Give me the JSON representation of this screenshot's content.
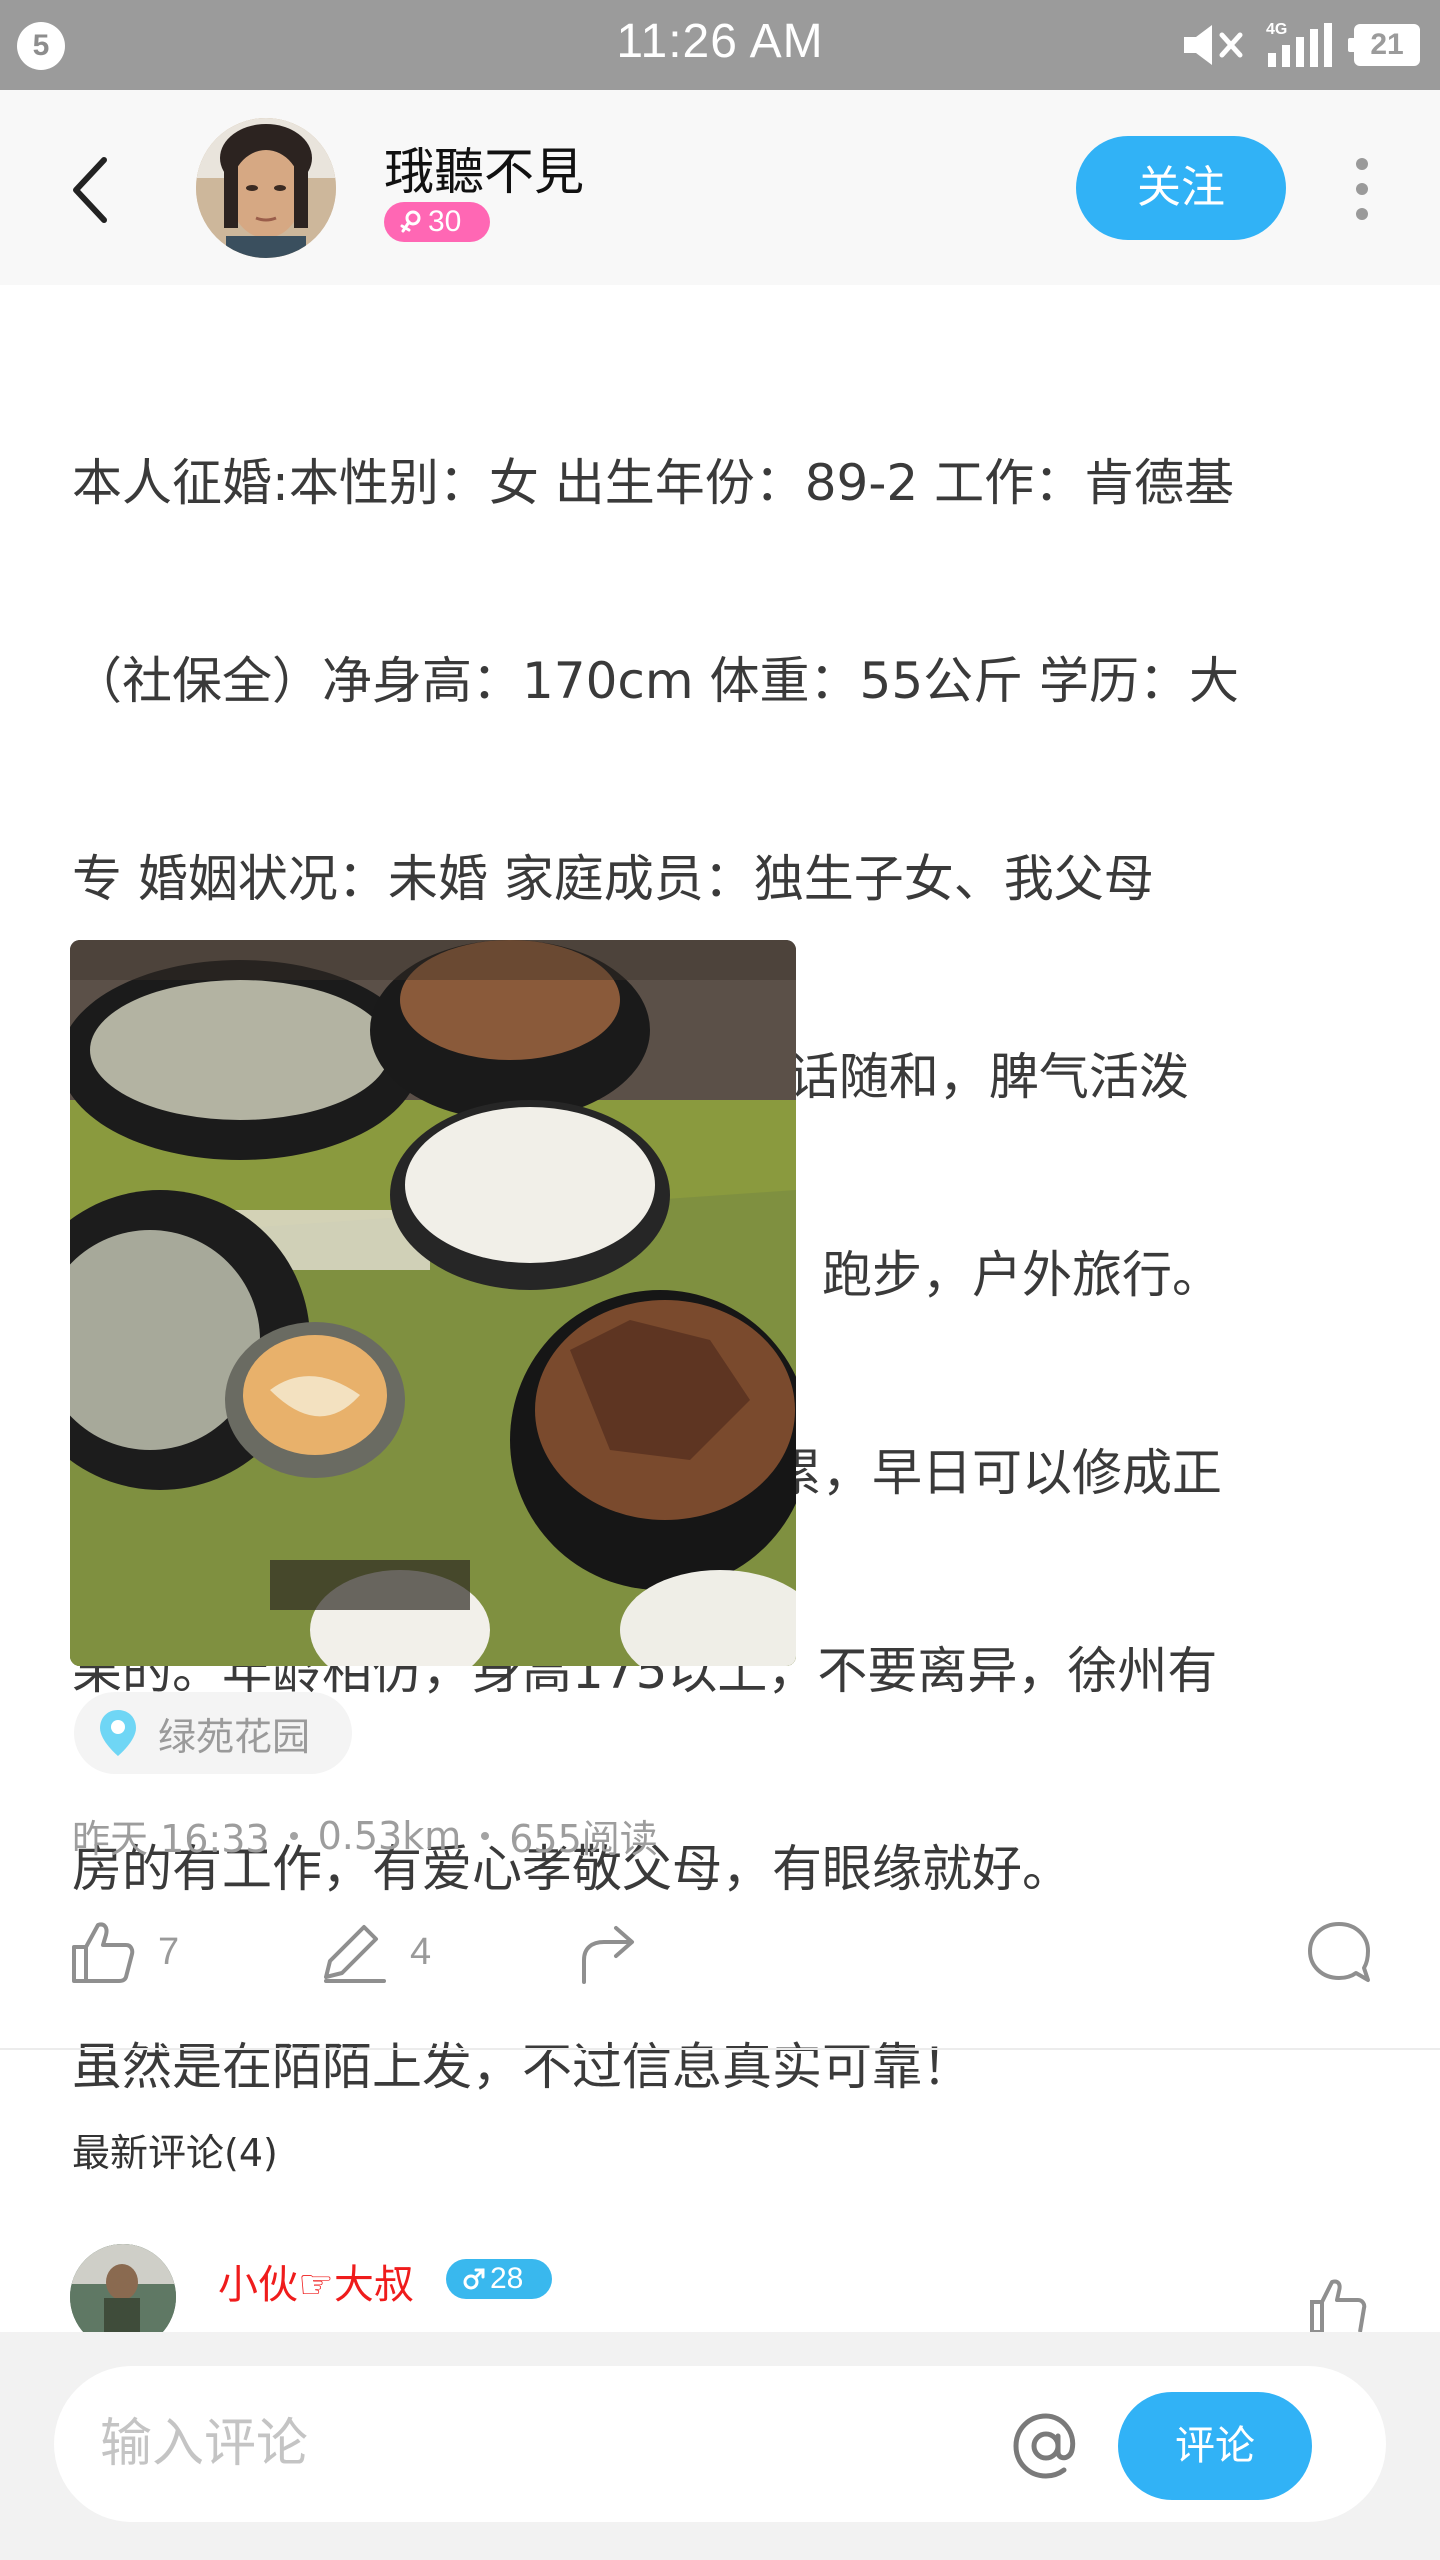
{
  "status_bar": {
    "notification_count": "5",
    "time": "11:26 AM",
    "network_label": "4G",
    "battery": "21",
    "icons": [
      "mute-icon",
      "signal-icon",
      "battery-icon"
    ]
  },
  "header": {
    "user_name": "珴聽不見",
    "gender_icon": "female-icon",
    "age": "30",
    "follow_label": "关注",
    "colors": {
      "accent": "#31b2f6",
      "female_badge": "#ff67b4",
      "male_badge": "#39b8ee"
    }
  },
  "post": {
    "text_lines": [
      "本人征婚:本性别：女 出生年份：89-2 工作：肯德基",
      "（社保全）净身高：170cm 体重：55公斤 学历：大",
      "专 婚姻状况：未婚 家庭成员：独生子女、我父母",
      "自我描述:听力不好戴助听器。说话随和，脾气活泼",
      "开朗大方。喜欢狗狗，打羽毛球，跑步，户外旅行。",
      "择偶要求：年龄大了找个相处不累，早日可以修成正",
      "果的。年龄相仿，身高175以上，不要离异，徐州有",
      "房的有工作，有爱心孝敬父母，有眼缘就好。",
      "虽然是在陌陌上发，不过信息真实可靠！"
    ],
    "photo_name": "food-photo",
    "location": "绿苑花园",
    "time": "昨天 16:33",
    "distance": "0.53km",
    "reads": "655阅读",
    "like_count": "7",
    "comment_count": "4"
  },
  "comments": {
    "title": "最新评论(4)",
    "items": [
      {
        "name": "小伙☞大叔",
        "gender_icon": "male-icon",
        "age": "28"
      }
    ]
  },
  "comment_bar": {
    "placeholder": "输入评论",
    "send_label": "评论"
  }
}
